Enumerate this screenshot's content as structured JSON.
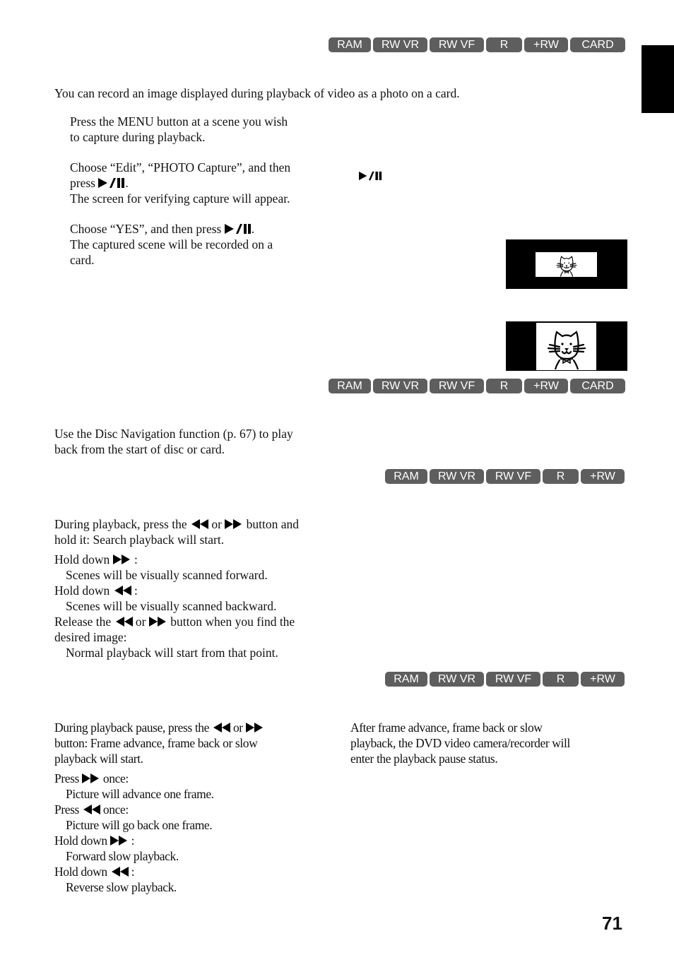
{
  "tab_marker": "section-tab",
  "page_number": "71",
  "badge_rows": [
    [
      "RAM",
      "RW VR",
      "RW VF",
      "R",
      "+RW",
      "CARD"
    ],
    [
      "RAM",
      "RW VR",
      "RW VF",
      "R",
      "+RW",
      "CARD"
    ],
    [
      "RAM",
      "RW VR",
      "RW VF",
      "R",
      "+RW"
    ],
    [
      "RAM",
      "RW VR",
      "RW VF",
      "R",
      "+RW"
    ]
  ],
  "capture": {
    "intro": "You can record an image displayed during playback of video as a photo on a card.",
    "step1_line1": "Press the MENU button at a scene you wish",
    "step1_line2": "to capture during playback.",
    "step2_line1": "Choose “Edit”, “PHOTO Capture”, and then",
    "step2_line2_pre": "press ",
    "step2_line2_post": ".",
    "step2_line3": "The screen for verifying capture will appear.",
    "step3_line1_pre": "Choose “YES”, and then press ",
    "step3_line1_post": ".",
    "step3_line2": "The captured scene will be recorded on a",
    "step3_line3": "card.",
    "screens": [
      "before-capture-screen",
      "captured-screen"
    ]
  },
  "from_start": {
    "line1": "Use the Disc Navigation function (p. 67) to play",
    "line2": "back from the start of disc or card."
  },
  "search": {
    "l1_a": "During playback, press the ",
    "l1_b": " or ",
    "l1_c": " button and",
    "l2": "hold it: Search playback will start.",
    "hold_fwd": "Hold down ",
    "colon": " :",
    "fwd_desc": "Scenes will be visually scanned forward.",
    "hold_back": "Hold down ",
    "back_desc": "Scenes will be visually scanned backward.",
    "rel_a": "Release the ",
    "rel_b": " or ",
    "rel_c": " button when you find the",
    "rel_2": "desired image:",
    "rel_desc": "Normal playback will start from that point."
  },
  "frame": {
    "l1_a": "During playback pause, press the ",
    "l1_b": " or ",
    "l2": "button: Frame advance, frame back or slow",
    "l3": "playback will start.",
    "press": "Press ",
    "once": " once:",
    "adv_desc": "Picture will advance one frame.",
    "back_desc": "Picture will go back one frame.",
    "hold": "Hold down ",
    "colon": " :",
    "fwd_slow": "Forward slow playback.",
    "rev_slow": "Reverse slow playback.",
    "note_1": "After frame advance, frame back or slow",
    "note_2": "playback, the DVD video camera/recorder will",
    "note_3": "enter the playback pause status."
  }
}
